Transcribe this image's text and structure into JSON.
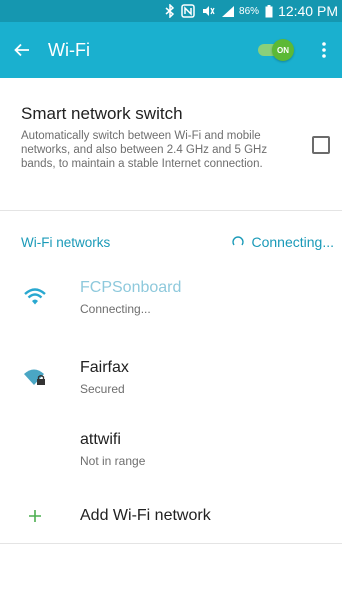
{
  "status_bar": {
    "battery_percent": "86%",
    "time": "12:40 PM"
  },
  "app_bar": {
    "title": "Wi-Fi",
    "toggle_label": "ON",
    "toggle_on": true
  },
  "smart_switch": {
    "title": "Smart network switch",
    "description": "Automatically switch between Wi-Fi and mobile networks, and also between 2.4 GHz and 5 GHz bands, to maintain a stable Internet connection.",
    "checked": false
  },
  "networks_section": {
    "title": "Wi-Fi networks",
    "status": "Connecting..."
  },
  "networks": [
    {
      "name": "FCPSonboard",
      "status": "Connecting...",
      "icon": "wifi-icon",
      "active": true
    },
    {
      "name": "Fairfax",
      "status": "Secured",
      "icon": "wifi-lock-icon",
      "active": false
    },
    {
      "name": "attwifi",
      "status": "Not in range",
      "icon": "none",
      "active": false
    }
  ],
  "add_network": {
    "label": "Add Wi-Fi network"
  },
  "colors": {
    "status_bar_bg": "#1597b0",
    "app_bar_bg": "#1ab0cf",
    "accent": "#1a9ab8",
    "toggle_green": "#5cb936",
    "add_plus_green": "#4caf50"
  }
}
